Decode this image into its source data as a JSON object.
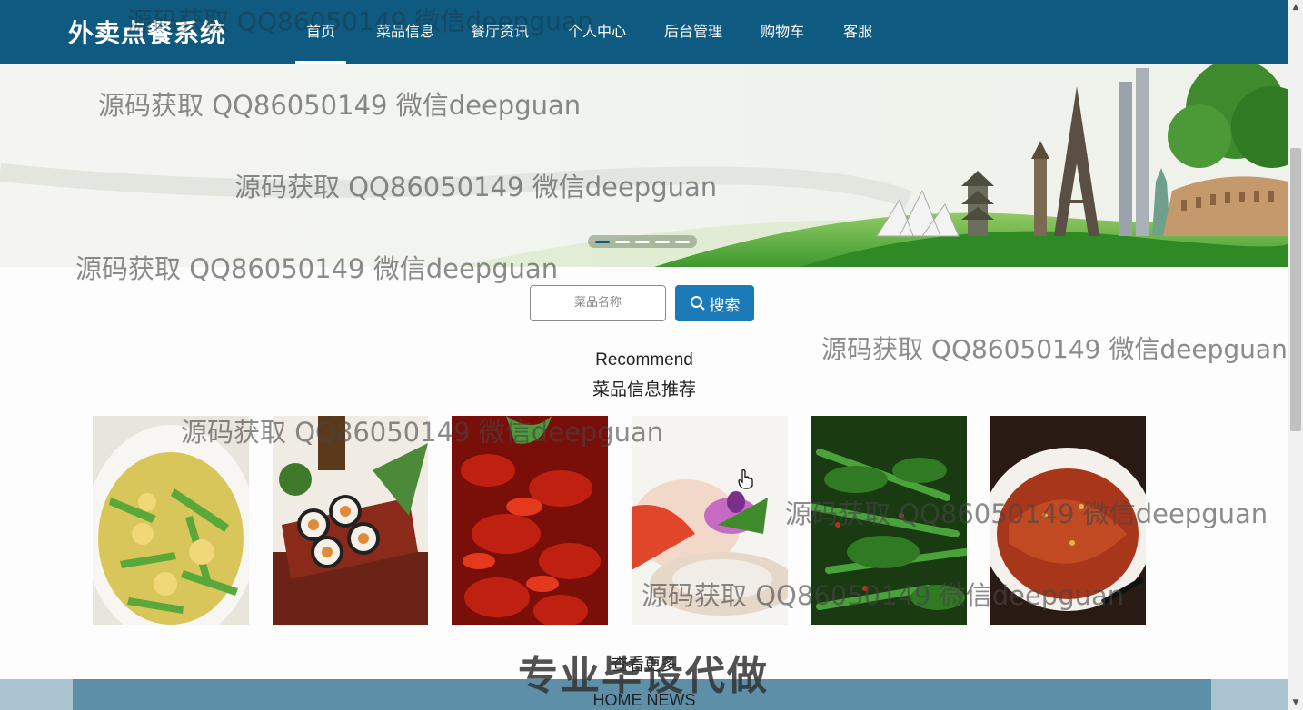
{
  "brand": "外卖点餐系统",
  "nav": [
    "首页",
    "菜品信息",
    "餐厅资讯",
    "个人中心",
    "后台管理",
    "购物车",
    "客服"
  ],
  "search": {
    "placeholder": "菜品名称",
    "button_label": "搜索"
  },
  "recommend": {
    "title_en": "Recommend",
    "title_cn": "菜品信息推荐"
  },
  "dishes": [
    "dish-1",
    "dish-2",
    "dish-3",
    "dish-4",
    "dish-5",
    "dish-6"
  ],
  "more_label": "查看更多",
  "news_title_en": "HOME NEWS",
  "watermark_text": "源码获取 QQ86050149 微信deepguan",
  "stamp_text": "专业毕设代做",
  "colors": {
    "nav_bg": "#0e5a80",
    "accent": "#1a7bb8",
    "band": "#5d8fa8"
  }
}
